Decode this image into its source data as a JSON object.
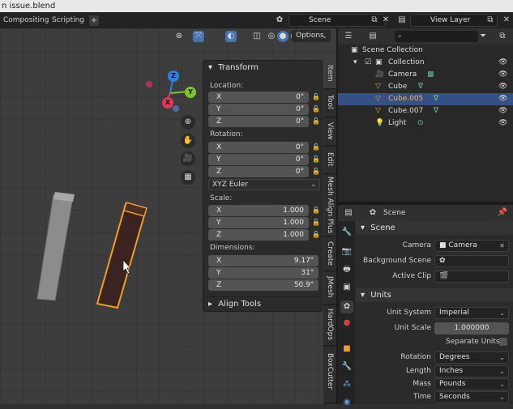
{
  "window": {
    "title": "n issue.blend"
  },
  "workspace_tabs": [
    "Compositing",
    "Scripting"
  ],
  "scene_selector": {
    "value": "Scene"
  },
  "view_layer_selector": {
    "value": "View Layer"
  },
  "viewport": {
    "options_label": "Options",
    "transform_panel": {
      "title": "Transform",
      "location_label": "Location:",
      "location": [
        {
          "axis": "X",
          "value": "0\""
        },
        {
          "axis": "Y",
          "value": "0\""
        },
        {
          "axis": "Z",
          "value": "0\""
        }
      ],
      "rotation_label": "Rotation:",
      "rotation": [
        {
          "axis": "X",
          "value": "0°"
        },
        {
          "axis": "Y",
          "value": "0°"
        },
        {
          "axis": "Z",
          "value": "0°"
        }
      ],
      "rotation_mode": "XYZ Euler",
      "scale_label": "Scale:",
      "scale": [
        {
          "axis": "X",
          "value": "1.000"
        },
        {
          "axis": "Y",
          "value": "1.000"
        },
        {
          "axis": "Z",
          "value": "1.000"
        }
      ],
      "dimensions_label": "Dimensions:",
      "dimensions": [
        {
          "axis": "X",
          "value": "9.17\""
        },
        {
          "axis": "Y",
          "value": "31\""
        },
        {
          "axis": "Z",
          "value": "50.9\""
        }
      ]
    },
    "align_tools_label": "Align Tools",
    "side_tabs": [
      "Item",
      "Tool",
      "View",
      "Edit",
      "Mesh Align Plus",
      "Create",
      "JMesh",
      "HardOps",
      "BoxCutter"
    ],
    "gizmo": {
      "x": "X",
      "y": "Y",
      "z": "Z"
    }
  },
  "outliner": {
    "search_placeholder": "",
    "rows": [
      {
        "label": "Scene Collection"
      },
      {
        "label": "Collection"
      },
      {
        "label": "Camera"
      },
      {
        "label": "Cube"
      },
      {
        "label": "Cube.005"
      },
      {
        "label": "Cube.007"
      },
      {
        "label": "Light"
      }
    ]
  },
  "properties": {
    "header_title": "Scene",
    "scene_section": "Scene",
    "camera_label": "Camera",
    "camera_value": "Camera",
    "background_scene_label": "Background Scene",
    "active_clip_label": "Active Clip",
    "units_section": "Units",
    "unit_system_label": "Unit System",
    "unit_system_value": "Imperial",
    "unit_scale_label": "Unit Scale",
    "unit_scale_value": "1.000000",
    "separate_units_label": "Separate Units",
    "rotation_label": "Rotation",
    "rotation_value": "Degrees",
    "length_label": "Length",
    "length_value": "Inches",
    "mass_label": "Mass",
    "mass_value": "Pounds",
    "time_label": "Time",
    "time_value": "Seconds"
  },
  "colors": {
    "selection": "#345085",
    "active_outline": "#f0a020",
    "accent": "#4772b3"
  }
}
